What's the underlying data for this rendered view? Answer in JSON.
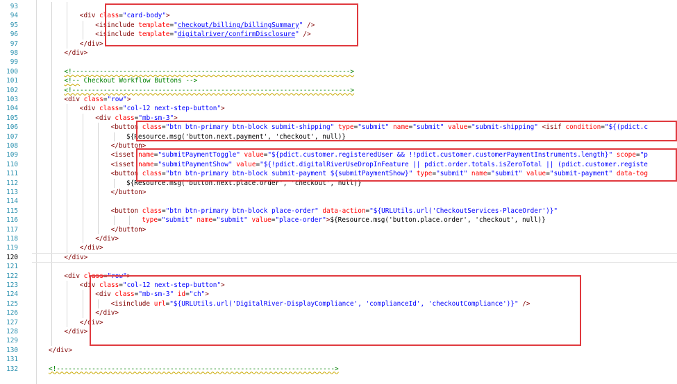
{
  "editor": {
    "current_line": 120,
    "lines": [
      {
        "num": 93,
        "indent": 4,
        "tokens": []
      },
      {
        "num": 94,
        "indent": 4,
        "tokens": [
          [
            "tag",
            "<div "
          ],
          [
            "attr",
            "class"
          ],
          [
            "text",
            "="
          ],
          [
            "val",
            "\"card-body\""
          ],
          [
            "tag",
            ">"
          ]
        ]
      },
      {
        "num": 95,
        "indent": 6,
        "tokens": [
          [
            "tag",
            "<isinclude "
          ],
          [
            "attr",
            "template"
          ],
          [
            "text",
            "="
          ],
          [
            "val",
            "\""
          ],
          [
            "link",
            "checkout/billing/billingSummary"
          ],
          [
            "val",
            "\""
          ],
          [
            "tag",
            " />"
          ]
        ]
      },
      {
        "num": 96,
        "indent": 6,
        "tokens": [
          [
            "tag",
            "<isinclude "
          ],
          [
            "attr",
            "template"
          ],
          [
            "text",
            "="
          ],
          [
            "val",
            "\""
          ],
          [
            "link",
            "digitalriver/confirmDisclosure"
          ],
          [
            "val",
            "\""
          ],
          [
            "tag",
            " />"
          ]
        ]
      },
      {
        "num": 97,
        "indent": 4,
        "tokens": [
          [
            "tag",
            "</div>"
          ]
        ]
      },
      {
        "num": 98,
        "indent": 2,
        "tokens": [
          [
            "tag",
            "</div>"
          ]
        ]
      },
      {
        "num": 99,
        "indent": 2,
        "tokens": []
      },
      {
        "num": 100,
        "indent": 2,
        "tokens": [
          [
            "err",
            "<!----------------------------------------------------------------------->"
          ]
        ]
      },
      {
        "num": 101,
        "indent": 2,
        "tokens": [
          [
            "err",
            "<!--"
          ],
          [
            "com",
            " Checkout Workflow Buttons -->"
          ]
        ]
      },
      {
        "num": 102,
        "indent": 2,
        "tokens": [
          [
            "err",
            "<!----------------------------------------------------------------------->"
          ]
        ]
      },
      {
        "num": 103,
        "indent": 2,
        "tokens": [
          [
            "tag",
            "<div "
          ],
          [
            "attr",
            "class"
          ],
          [
            "text",
            "="
          ],
          [
            "val",
            "\"row\""
          ],
          [
            "tag",
            ">"
          ]
        ]
      },
      {
        "num": 104,
        "indent": 4,
        "tokens": [
          [
            "tag",
            "<div "
          ],
          [
            "attr",
            "class"
          ],
          [
            "text",
            "="
          ],
          [
            "val",
            "\"col-12 next-step-button\""
          ],
          [
            "tag",
            ">"
          ]
        ]
      },
      {
        "num": 105,
        "indent": 6,
        "tokens": [
          [
            "tag",
            "<div "
          ],
          [
            "attr",
            "class"
          ],
          [
            "text",
            "="
          ],
          [
            "val",
            "\"mb-sm-3\""
          ],
          [
            "tag",
            ">"
          ]
        ]
      },
      {
        "num": 106,
        "indent": 8,
        "tokens": [
          [
            "tag",
            "<button "
          ],
          [
            "attr",
            "class"
          ],
          [
            "text",
            "="
          ],
          [
            "val",
            "\"btn btn-primary btn-block submit-shipping\""
          ],
          [
            "attr",
            " type"
          ],
          [
            "text",
            "="
          ],
          [
            "val",
            "\"submit\""
          ],
          [
            "attr",
            " name"
          ],
          [
            "text",
            "="
          ],
          [
            "val",
            "\"submit\""
          ],
          [
            "attr",
            " value"
          ],
          [
            "text",
            "="
          ],
          [
            "val",
            "\"submit-shipping\""
          ],
          [
            "tag",
            " <isif "
          ],
          [
            "attr",
            "condition"
          ],
          [
            "text",
            "="
          ],
          [
            "val",
            "\"${(pdict.c"
          ]
        ]
      },
      {
        "num": 107,
        "indent": 10,
        "tokens": [
          [
            "text",
            "${Resource.msg('button.next.payment', 'checkout', null)}"
          ]
        ]
      },
      {
        "num": 108,
        "indent": 8,
        "tokens": [
          [
            "tag",
            "</button>"
          ]
        ]
      },
      {
        "num": 109,
        "indent": 8,
        "tokens": [
          [
            "tag",
            "<isset "
          ],
          [
            "attr",
            "name"
          ],
          [
            "text",
            "="
          ],
          [
            "val",
            "\"submitPaymentToggle\""
          ],
          [
            "attr",
            " value"
          ],
          [
            "text",
            "="
          ],
          [
            "val",
            "\"${pdict.customer.registeredUser && !!pdict.customer.customerPaymentInstruments.length}\""
          ],
          [
            "attr",
            " scope"
          ],
          [
            "text",
            "="
          ],
          [
            "val",
            "\"p"
          ]
        ]
      },
      {
        "num": 110,
        "indent": 8,
        "tokens": [
          [
            "tag",
            "<isset "
          ],
          [
            "attr",
            "name"
          ],
          [
            "text",
            "="
          ],
          [
            "val",
            "\"submitPaymentShow\""
          ],
          [
            "attr",
            " value"
          ],
          [
            "text",
            "="
          ],
          [
            "val",
            "\"${!pdict.digitalRiverUseDropInFeature || pdict.order.totals.isZeroTotal || (pdict.customer.registe"
          ]
        ]
      },
      {
        "num": 111,
        "indent": 8,
        "tokens": [
          [
            "tag",
            "<button "
          ],
          [
            "attr",
            "class"
          ],
          [
            "text",
            "="
          ],
          [
            "val",
            "\"btn btn-primary btn-block submit-payment ${submitPaymentShow}\""
          ],
          [
            "attr",
            " type"
          ],
          [
            "text",
            "="
          ],
          [
            "val",
            "\"submit\""
          ],
          [
            "attr",
            " name"
          ],
          [
            "text",
            "="
          ],
          [
            "val",
            "\"submit\""
          ],
          [
            "attr",
            " value"
          ],
          [
            "text",
            "="
          ],
          [
            "val",
            "\"submit-payment\""
          ],
          [
            "attr",
            " data-tog"
          ]
        ]
      },
      {
        "num": 112,
        "indent": 10,
        "tokens": [
          [
            "text",
            "${Resource.msg('button.next.place.order', 'checkout', null)}"
          ]
        ]
      },
      {
        "num": 113,
        "indent": 8,
        "tokens": [
          [
            "tag",
            "</button>"
          ]
        ]
      },
      {
        "num": 114,
        "indent": 8,
        "tokens": []
      },
      {
        "num": 115,
        "indent": 8,
        "tokens": [
          [
            "tag",
            "<button "
          ],
          [
            "attr",
            "class"
          ],
          [
            "text",
            "="
          ],
          [
            "val",
            "\"btn btn-primary btn-block place-order\""
          ],
          [
            "attr",
            " data-action"
          ],
          [
            "text",
            "="
          ],
          [
            "val",
            "\"${URLUtils.url('CheckoutServices-PlaceOrder')}\""
          ]
        ]
      },
      {
        "num": 116,
        "indent": 12,
        "tokens": [
          [
            "attr",
            "type"
          ],
          [
            "text",
            "="
          ],
          [
            "val",
            "\"submit\""
          ],
          [
            "attr",
            " name"
          ],
          [
            "text",
            "="
          ],
          [
            "val",
            "\"submit\""
          ],
          [
            "attr",
            " value"
          ],
          [
            "text",
            "="
          ],
          [
            "val",
            "\"place-order\""
          ],
          [
            "tag",
            ">"
          ],
          [
            "text",
            "${Resource.msg('button.place.order', 'checkout', null)}"
          ]
        ]
      },
      {
        "num": 117,
        "indent": 8,
        "tokens": [
          [
            "tag",
            "</button>"
          ]
        ]
      },
      {
        "num": 118,
        "indent": 6,
        "tokens": [
          [
            "tag",
            "</div>"
          ]
        ]
      },
      {
        "num": 119,
        "indent": 4,
        "tokens": [
          [
            "tag",
            "</div>"
          ]
        ]
      },
      {
        "num": 120,
        "indent": 2,
        "tokens": [
          [
            "tag",
            "</div>"
          ]
        ]
      },
      {
        "num": 121,
        "indent": 2,
        "tokens": []
      },
      {
        "num": 122,
        "indent": 2,
        "tokens": [
          [
            "tag",
            "<div "
          ],
          [
            "attr",
            "class"
          ],
          [
            "text",
            "="
          ],
          [
            "val",
            "\"row\""
          ],
          [
            "tag",
            ">"
          ]
        ]
      },
      {
        "num": 123,
        "indent": 4,
        "tokens": [
          [
            "tag",
            "<div "
          ],
          [
            "attr",
            "class"
          ],
          [
            "text",
            "="
          ],
          [
            "val",
            "\"col-12 next-step-button\""
          ],
          [
            "tag",
            ">"
          ]
        ]
      },
      {
        "num": 124,
        "indent": 6,
        "tokens": [
          [
            "tag",
            "<div "
          ],
          [
            "attr",
            "class"
          ],
          [
            "text",
            "="
          ],
          [
            "val",
            "\"mb-sm-3\""
          ],
          [
            "attr",
            " id"
          ],
          [
            "text",
            "="
          ],
          [
            "val",
            "\"ch\""
          ],
          [
            "tag",
            ">"
          ]
        ]
      },
      {
        "num": 125,
        "indent": 8,
        "tokens": [
          [
            "tag",
            "<isinclude "
          ],
          [
            "attr",
            "url"
          ],
          [
            "text",
            "="
          ],
          [
            "val",
            "\"${URLUtils.url('DigitalRiver-DisplayCompliance', 'complianceId', 'checkoutCompliance')}\""
          ],
          [
            "tag",
            " />"
          ]
        ]
      },
      {
        "num": 126,
        "indent": 6,
        "tokens": [
          [
            "tag",
            "</div>"
          ]
        ]
      },
      {
        "num": 127,
        "indent": 4,
        "tokens": [
          [
            "tag",
            "</div>"
          ]
        ]
      },
      {
        "num": 128,
        "indent": 2,
        "tokens": [
          [
            "tag",
            "</div>"
          ]
        ]
      },
      {
        "num": 129,
        "indent": 2,
        "tokens": []
      },
      {
        "num": 130,
        "indent": 0,
        "tokens": [
          [
            "tag",
            "</div>"
          ]
        ]
      },
      {
        "num": 131,
        "indent": 0,
        "tokens": []
      },
      {
        "num": 132,
        "indent": 0,
        "tokens": [
          [
            "err",
            "<!----------------------------------------------------------------------->"
          ]
        ]
      }
    ]
  },
  "colors": {
    "tag": "#800000",
    "attribute": "#ff0000",
    "value": "#0000ff",
    "comment": "#008000",
    "line_number": "#2b91af",
    "highlight_box": "#e0393e"
  }
}
